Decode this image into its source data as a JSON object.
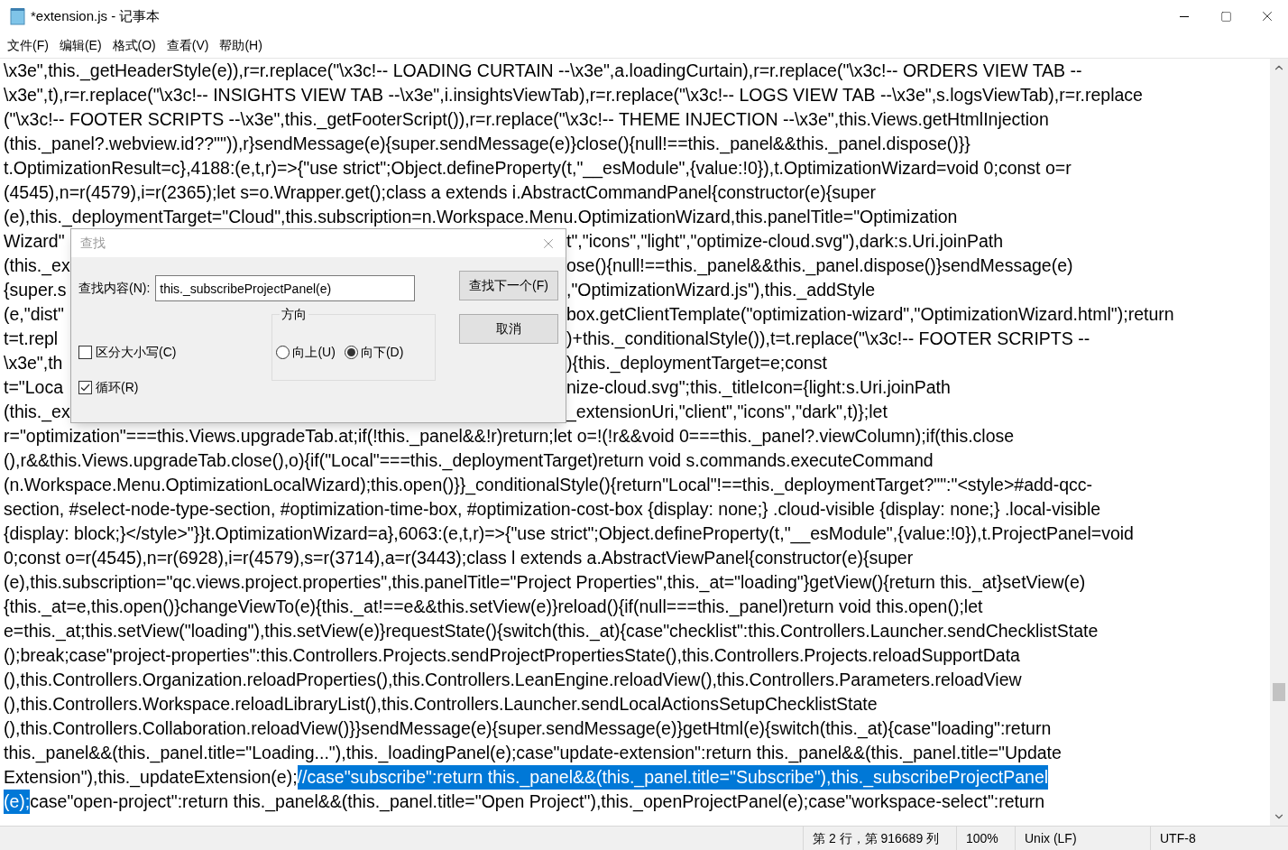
{
  "window": {
    "title": "*extension.js - 记事本"
  },
  "menu": [
    "文件(F)",
    "编辑(E)",
    "格式(O)",
    "查看(V)",
    "帮助(H)"
  ],
  "editor": {
    "lines": [
      {
        "kind": "full",
        "parts": [
          {
            "text": "\\x3e\",this._getHeaderStyle(e)),r=r.replace(\"\\x3c!-- LOADING CURTAIN --\\x3e\",a.loadingCurtain),r=r.replace(\"\\x3c!-- ORDERS VIEW TAB --",
            "selected": false
          }
        ]
      },
      {
        "kind": "full",
        "parts": [
          {
            "text": "\\x3e\",t),r=r.replace(\"\\x3c!-- INSIGHTS VIEW TAB --\\x3e\",i.insightsViewTab),r=r.replace(\"\\x3c!-- LOGS VIEW TAB --\\x3e\",s.logsViewTab),r=r.replace",
            "selected": false
          }
        ]
      },
      {
        "kind": "full",
        "parts": [
          {
            "text": "(\"\\x3c!-- FOOTER SCRIPTS --\\x3e\",this._getFooterScript()),r=r.replace(\"\\x3c!-- THEME INJECTION --\\x3e\",this.Views.getHtmlInjection",
            "selected": false
          }
        ]
      },
      {
        "kind": "full",
        "parts": [
          {
            "text": "(this._panel?.webview.id??\"\")),r}sendMessage(e){super.sendMessage(e)}close(){null!==this._panel&&this._panel.dispose()}}",
            "selected": false
          }
        ]
      },
      {
        "kind": "full",
        "parts": [
          {
            "text": "t.OptimizationResult=c},4188:(e,t,r)=>{\"use strict\";Object.defineProperty(t,\"__esModule\",{value:!0}),t.OptimizationWizard=void 0;const o=r",
            "selected": false
          }
        ]
      },
      {
        "kind": "full",
        "parts": [
          {
            "text": "(4545),n=r(4579),i=r(2365);let s=o.Wrapper.get();class a extends i.AbstractCommandPanel{constructor(e){super",
            "selected": false
          }
        ]
      },
      {
        "kind": "full",
        "parts": [
          {
            "text": "(e),this._deploymentTarget=\"Cloud\",this.subscription=n.Workspace.Menu.OptimizationWizard,this.panelTitle=\"Optimization",
            "selected": false
          }
        ]
      },
      {
        "kind": "split",
        "left": "Wizard\"",
        "right": "t\",\"icons\",\"light\",\"optimize-cloud.svg\"),dark:s.Uri.joinPath"
      },
      {
        "kind": "split",
        "left": "(this._ex",
        "right": "ose(){null!==this._panel&&this._panel.dispose()}sendMessage(e)"
      },
      {
        "kind": "split",
        "left": "{super.s",
        "right": ",\"OptimizationWizard.js\"),this._addStyle"
      },
      {
        "kind": "split",
        "left": "(e,\"dist\"",
        "right": "box.getClientTemplate(\"optimization-wizard\",\"OptimizationWizard.html\");return"
      },
      {
        "kind": "split",
        "left": "t=t.repl",
        "right": ")+this._conditionalStyle()),t=t.replace(\"\\x3c!-- FOOTER SCRIPTS --"
      },
      {
        "kind": "split",
        "left": "\\x3e\",th",
        "right": "){this._deploymentTarget=e;const"
      },
      {
        "kind": "split",
        "left": "t=\"Loca",
        "right": "nize-cloud.svg\";this._titleIcon={light:s.Uri.joinPath"
      },
      {
        "kind": "split",
        "left": "(this._ex",
        "right": "_extensionUri,\"client\",\"icons\",\"dark\",t)};let"
      },
      {
        "kind": "full",
        "parts": [
          {
            "text": "r=\"optimization\"===this.Views.upgradeTab.at;if(!this._panel&&!r)return;let o=!(!r&&void 0===this._panel?.viewColumn);if(this.close",
            "selected": false
          }
        ]
      },
      {
        "kind": "full",
        "parts": [
          {
            "text": "(),r&&this.Views.upgradeTab.close(),o){if(\"Local\"===this._deploymentTarget)return void s.commands.executeCommand",
            "selected": false
          }
        ]
      },
      {
        "kind": "full",
        "parts": [
          {
            "text": "(n.Workspace.Menu.OptimizationLocalWizard);this.open()}}_conditionalStyle(){return\"Local\"!==this._deploymentTarget?\"\":\"<style>#add-qcc-",
            "selected": false
          }
        ]
      },
      {
        "kind": "full",
        "parts": [
          {
            "text": "section, #select-node-type-section, #optimization-time-box, #optimization-cost-box {display: none;} .cloud-visible {display: none;} .local-visible",
            "selected": false
          }
        ]
      },
      {
        "kind": "full",
        "parts": [
          {
            "text": "{display: block;}</style>\"}}t.OptimizationWizard=a},6063:(e,t,r)=>{\"use strict\";Object.defineProperty(t,\"__esModule\",{value:!0}),t.ProjectPanel=void",
            "selected": false
          }
        ]
      },
      {
        "kind": "full",
        "parts": [
          {
            "text": "0;const o=r(4545),n=r(6928),i=r(4579),s=r(3714),a=r(3443);class l extends a.AbstractViewPanel{constructor(e){super",
            "selected": false
          }
        ]
      },
      {
        "kind": "full",
        "parts": [
          {
            "text": "(e),this.subscription=\"qc.views.project.properties\",this.panelTitle=\"Project Properties\",this._at=\"loading\"}getView(){return this._at}setView(e)",
            "selected": false
          }
        ]
      },
      {
        "kind": "full",
        "parts": [
          {
            "text": "{this._at=e,this.open()}changeViewTo(e){this._at!==e&&this.setView(e)}reload(){if(null===this._panel)return void this.open();let",
            "selected": false
          }
        ]
      },
      {
        "kind": "full",
        "parts": [
          {
            "text": "e=this._at;this.setView(\"loading\"),this.setView(e)}requestState(){switch(this._at){case\"checklist\":this.Controllers.Launcher.sendChecklistState",
            "selected": false
          }
        ]
      },
      {
        "kind": "full",
        "parts": [
          {
            "text": "();break;case\"project-properties\":this.Controllers.Projects.sendProjectPropertiesState(),this.Controllers.Projects.reloadSupportData",
            "selected": false
          }
        ]
      },
      {
        "kind": "full",
        "parts": [
          {
            "text": "(),this.Controllers.Organization.reloadProperties(),this.Controllers.LeanEngine.reloadView(),this.Controllers.Parameters.reloadView",
            "selected": false
          }
        ]
      },
      {
        "kind": "full",
        "parts": [
          {
            "text": "(),this.Controllers.Workspace.reloadLibraryList(),this.Controllers.Launcher.sendLocalActionsSetupChecklistState",
            "selected": false
          }
        ]
      },
      {
        "kind": "full",
        "parts": [
          {
            "text": "(),this.Controllers.Collaboration.reloadView()}}sendMessage(e){super.sendMessage(e)}getHtml(e){switch(this._at){case\"loading\":return",
            "selected": false
          }
        ]
      },
      {
        "kind": "full",
        "parts": [
          {
            "text": "this._panel&&(this._panel.title=\"Loading...\"),this._loadingPanel(e);case\"update-extension\":return this._panel&&(this._panel.title=\"Update",
            "selected": false
          }
        ]
      },
      {
        "kind": "full",
        "parts": [
          {
            "text": "Extension\"),this._updateExtension(e);",
            "selected": false
          },
          {
            "text": "//case\"subscribe\":return this._panel&&(this._panel.title=\"Subscribe\"),this._subscribeProjectPanel",
            "selected": true
          }
        ]
      },
      {
        "kind": "full",
        "parts": [
          {
            "text": "(e);",
            "selected": true
          },
          {
            "text": "case\"open-project\":return this._panel&&(this._panel.title=\"Open Project\"),this._openProjectPanel(e);case\"workspace-select\":return",
            "selected": false
          }
        ]
      }
    ]
  },
  "find_dialog": {
    "title": "查找",
    "find_label": "查找内容(N):",
    "find_value": "this._subscribeProjectPanel(e)",
    "find_next_button": "查找下一个(F)",
    "cancel_button": "取消",
    "direction": {
      "label": "方向",
      "options": [
        {
          "label": "向上(U)",
          "selected": false
        },
        {
          "label": "向下(D)",
          "selected": true
        }
      ]
    },
    "options": [
      {
        "label": "区分大小写(C)",
        "checked": false
      },
      {
        "label": "循环(R)",
        "checked": true
      }
    ]
  },
  "status_bar": {
    "position": "第 2 行，第 916689 列",
    "zoom": "100%",
    "line_ending": "Unix (LF)",
    "encoding": "UTF-8"
  }
}
